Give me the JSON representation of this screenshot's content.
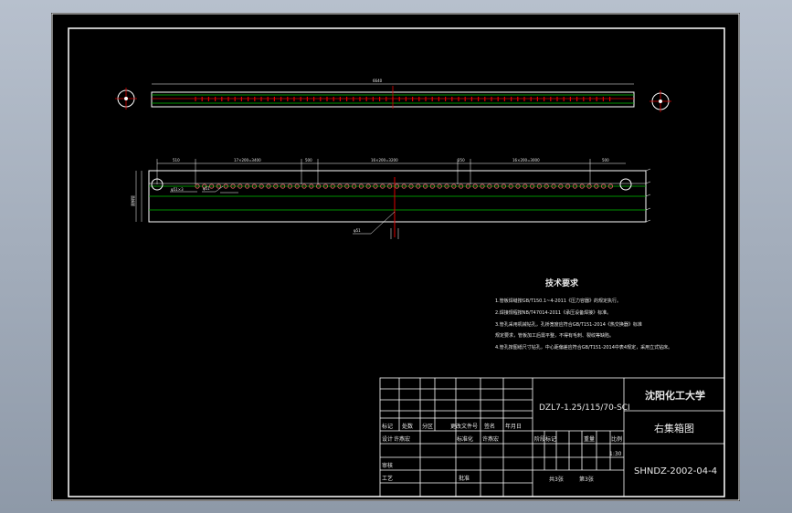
{
  "notes": {
    "title": "技术要求",
    "lines": [
      "1.管板焊缝按GB/T150.1~4-2011《压力容器》的规定执行。",
      "2.焊接规程按NB/T47014-2011《承压设备焊接》标准。",
      "3.管孔采用机械钻孔，孔桥宽度应符合GB/T151-2014《热交换器》标准",
      "规定要求，管板加工后需平整，不得有毛刺、裂纹等缺陷。",
      "4.管孔按图纸尺寸钻孔，中心距偏差应符合GB/T151-2014中表4规定，采用立式钻床。"
    ]
  },
  "title_block": {
    "university": "沈阳化工大学",
    "drawing_name": "右集箱图",
    "model": "DZL7-1.25/115/70-SCI",
    "drawing_number": "SHNDZ-2002-04-4",
    "scale": "1:30",
    "sheets_total": "共3张",
    "sheet_no": "第3张",
    "labels": {
      "mark": "标记",
      "count": "处数",
      "zone": "分区",
      "change_doc": "更改文件号",
      "sign": "签名",
      "date": "年月日",
      "design": "设计",
      "standardize": "标准化",
      "check": "审核",
      "process": "工艺",
      "approve": "批准",
      "stage_mark": "阶段标记",
      "weight": "重量",
      "ratio": "比例"
    },
    "people": {
      "designer": "许燕宏",
      "standardizer": "许燕宏"
    }
  },
  "dimensions": {
    "overall": "6640",
    "pitch_left": "17×200=3400",
    "pitch_mid": "16×200=3200",
    "pitch_right": "16×200=3000",
    "d1": "510",
    "d2": "500",
    "d3": "250",
    "d4": "500",
    "left_vertical": "圆钢管",
    "hole_note_1": "φ51×3",
    "hole_note_2": "φ51",
    "hole_note_3": "φ51"
  },
  "colors": {
    "background": "#000000",
    "frame": "#ffffff",
    "green_line": "#00c000",
    "red_line": "#e00000",
    "dim_text": "#e8e8e8"
  }
}
